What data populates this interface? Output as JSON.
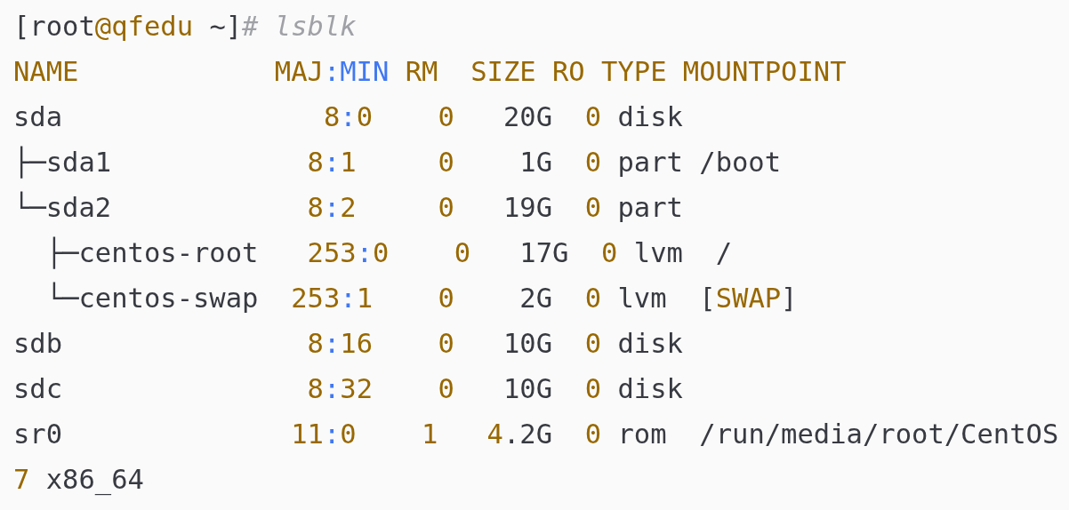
{
  "code_block": {
    "lines": [
      {
        "tokens": [
          {
            "t": "[root",
            "kind": "plain"
          },
          {
            "t": "@qfedu",
            "kind": "number"
          },
          {
            "t": " ~]",
            "kind": "plain"
          },
          {
            "t": "# lsblk",
            "kind": "comment"
          }
        ]
      },
      {
        "tokens": [
          {
            "t": "NAME            MAJ",
            "kind": "number"
          },
          {
            "t": ":MIN",
            "kind": "punct"
          },
          {
            "t": " RM  SIZE RO TYPE MOUNTPOINT",
            "kind": "number"
          }
        ]
      },
      {
        "tokens": [
          {
            "t": "sda                ",
            "kind": "plain"
          },
          {
            "t": "8",
            "kind": "number"
          },
          {
            "t": ":",
            "kind": "punct"
          },
          {
            "t": "0    0",
            "kind": "number"
          },
          {
            "t": "   20G  ",
            "kind": "plain"
          },
          {
            "t": "0",
            "kind": "number"
          },
          {
            "t": " disk",
            "kind": "plain"
          }
        ]
      },
      {
        "tokens": [
          {
            "t": "├─sda1            ",
            "kind": "plain"
          },
          {
            "t": "8",
            "kind": "number"
          },
          {
            "t": ":",
            "kind": "punct"
          },
          {
            "t": "1     0",
            "kind": "number"
          },
          {
            "t": "    1G  ",
            "kind": "plain"
          },
          {
            "t": "0",
            "kind": "number"
          },
          {
            "t": " part /boot",
            "kind": "plain"
          }
        ]
      },
      {
        "tokens": [
          {
            "t": "└─sda2            ",
            "kind": "plain"
          },
          {
            "t": "8",
            "kind": "number"
          },
          {
            "t": ":",
            "kind": "punct"
          },
          {
            "t": "2     0",
            "kind": "number"
          },
          {
            "t": "   19G  ",
            "kind": "plain"
          },
          {
            "t": "0",
            "kind": "number"
          },
          {
            "t": " part",
            "kind": "plain"
          }
        ]
      },
      {
        "tokens": [
          {
            "t": "  ├─centos-root   ",
            "kind": "plain"
          },
          {
            "t": "253",
            "kind": "number"
          },
          {
            "t": ":",
            "kind": "punct"
          },
          {
            "t": "0    0",
            "kind": "number"
          },
          {
            "t": "   17G  ",
            "kind": "plain"
          },
          {
            "t": "0",
            "kind": "number"
          },
          {
            "t": " lvm  /",
            "kind": "plain"
          }
        ]
      },
      {
        "tokens": [
          {
            "t": "  └─centos-swap  ",
            "kind": "plain"
          },
          {
            "t": "253",
            "kind": "number"
          },
          {
            "t": ":",
            "kind": "punct"
          },
          {
            "t": "1    0",
            "kind": "number"
          },
          {
            "t": "    2G  ",
            "kind": "plain"
          },
          {
            "t": "0",
            "kind": "number"
          },
          {
            "t": " lvm  [",
            "kind": "plain"
          },
          {
            "t": "SWAP",
            "kind": "number"
          },
          {
            "t": "]",
            "kind": "plain"
          }
        ]
      },
      {
        "tokens": [
          {
            "t": "sdb               ",
            "kind": "plain"
          },
          {
            "t": "8",
            "kind": "number"
          },
          {
            "t": ":",
            "kind": "punct"
          },
          {
            "t": "16    0",
            "kind": "number"
          },
          {
            "t": "   10G  ",
            "kind": "plain"
          },
          {
            "t": "0",
            "kind": "number"
          },
          {
            "t": " disk",
            "kind": "plain"
          }
        ]
      },
      {
        "tokens": [
          {
            "t": "sdc               ",
            "kind": "plain"
          },
          {
            "t": "8",
            "kind": "number"
          },
          {
            "t": ":",
            "kind": "punct"
          },
          {
            "t": "32    0",
            "kind": "number"
          },
          {
            "t": "   10G  ",
            "kind": "plain"
          },
          {
            "t": "0",
            "kind": "number"
          },
          {
            "t": " disk",
            "kind": "plain"
          }
        ]
      },
      {
        "tokens": [
          {
            "t": "sr0              ",
            "kind": "plain"
          },
          {
            "t": "11",
            "kind": "number"
          },
          {
            "t": ":",
            "kind": "punct"
          },
          {
            "t": "0    1   4",
            "kind": "number"
          },
          {
            "t": ".2G  ",
            "kind": "plain"
          },
          {
            "t": "0",
            "kind": "number"
          },
          {
            "t": " rom  /run/media/root/CentOS",
            "kind": "plain"
          }
        ]
      },
      {
        "tokens": [
          {
            "t": "7",
            "kind": "number"
          },
          {
            "t": " x86_64",
            "kind": "plain"
          }
        ]
      }
    ]
  }
}
